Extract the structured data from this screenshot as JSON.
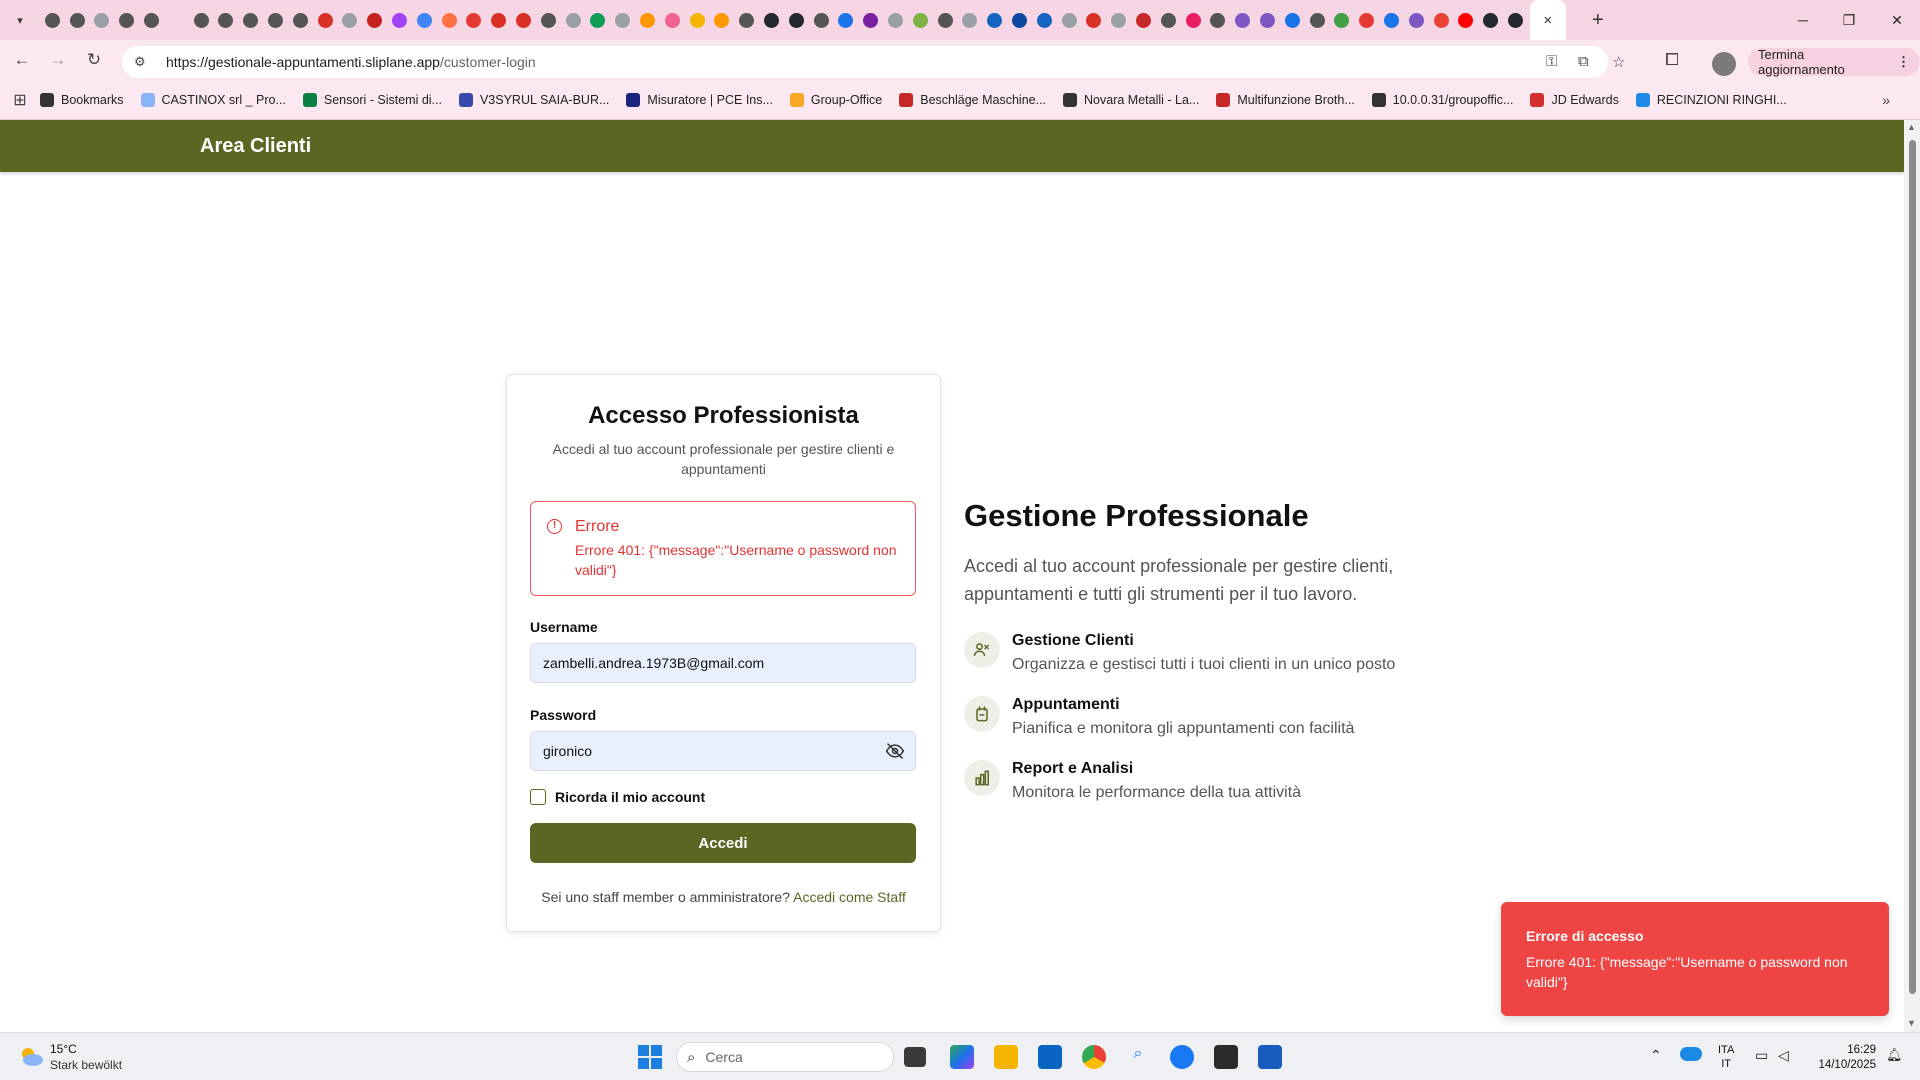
{
  "browser": {
    "tab_favicon_colors": [
      "#555555",
      "#555555",
      "#9aa0a6",
      "#555555",
      "#555555",
      "#f6d6e4",
      "#555555",
      "#555555",
      "#555555",
      "#555555",
      "#555555",
      "#d93025",
      "#9aa0a6",
      "#c5221f",
      "#a142f4",
      "#4285f4",
      "#ff7043",
      "#e53935",
      "#d93025",
      "#d93025",
      "#555555",
      "#9aa0a6",
      "#0f9d58",
      "#9aa0a6",
      "#ff9800",
      "#f06292",
      "#f4b400",
      "#ff9800",
      "#555555",
      "#24292f",
      "#24292f",
      "#555555",
      "#1a73e8",
      "#7b1fa2",
      "#9aa0a6",
      "#7cb342",
      "#555555",
      "#9aa0a6",
      "#1565c0",
      "#0d47a1",
      "#1565c0",
      "#9aa0a6",
      "#d93025",
      "#9aa0a6",
      "#c62828",
      "#555555",
      "#e91e63",
      "#555555",
      "#7e57c2",
      "#7e57c2",
      "#1a73e8",
      "#555555",
      "#43a047",
      "#e53935",
      "#1a73e8",
      "#7e57c2",
      "#ea4335",
      "#ff0000",
      "#24292f",
      "#24292f"
    ],
    "active_tab_close": "×",
    "new_tab": "+",
    "window_controls": {
      "minimize": "─",
      "maximize": "❐",
      "close": "✕"
    },
    "nav": {
      "back": "←",
      "forward": "→",
      "reload": "↻"
    },
    "url_host": "https://gestionale-appuntamenti.sliplane.app",
    "url_path": "/customer-login",
    "update_chip": "Termina aggiornamento",
    "bookmarks": [
      {
        "label": "Bookmarks",
        "color": "#333333"
      },
      {
        "label": "CASTINOX srl _ Pro...",
        "color": "#8ab4f8"
      },
      {
        "label": "Sensori - Sistemi di...",
        "color": "#0b8043"
      },
      {
        "label": "V3SYRUL SAIA-BUR...",
        "color": "#3949ab"
      },
      {
        "label": "Misuratore | PCE Ins...",
        "color": "#1a237e"
      },
      {
        "label": "Group-Office",
        "color": "#f9a825"
      },
      {
        "label": "Beschläge Maschine...",
        "color": "#c62828"
      },
      {
        "label": "Novara Metalli - La...",
        "color": "#333333"
      },
      {
        "label": "Multifunzione Broth...",
        "color": "#c62828"
      },
      {
        "label": "10.0.0.31/groupoffic...",
        "color": "#333333"
      },
      {
        "label": "JD Edwards",
        "color": "#d32f2f"
      },
      {
        "label": "RECINZIONI RINGHI...",
        "color": "#1e88e5"
      }
    ]
  },
  "app": {
    "header_title": "Area Clienti",
    "login": {
      "title": "Accesso Professionista",
      "subtitle": "Accedi al tuo account professionale per gestire clienti e appuntamenti",
      "error_title": "Errore",
      "error_message": "Errore 401: {\"message\":\"Username o password non validi\"}",
      "username_label": "Username",
      "username_value": "zambelli.andrea.1973B@gmail.com",
      "password_label": "Password",
      "password_value": "gironico",
      "remember_label": "Ricorda il mio account",
      "submit_label": "Accedi",
      "staff_prompt": "Sei uno staff member o amministratore?",
      "staff_link": "Accedi come Staff"
    },
    "info": {
      "title": "Gestione Professionale",
      "text": "Accedi al tuo account professionale per gestire clienti, appuntamenti e tutti gli strumenti per il tuo lavoro.",
      "features": [
        {
          "title": "Gestione Clienti",
          "desc": "Organizza e gestisci tutti i tuoi clienti in un unico posto",
          "icon": "users-icon"
        },
        {
          "title": "Appuntamenti",
          "desc": "Pianifica e monitora gli appuntamenti con facilità",
          "icon": "calendar-icon"
        },
        {
          "title": "Report e Analisi",
          "desc": "Monitora le performance della tua attività",
          "icon": "bar-chart-icon"
        }
      ]
    },
    "toast": {
      "title": "Errore di accesso",
      "message": "Errore 401: {\"message\":\"Username o password non validi\"}"
    },
    "accent_color": "#5c6623",
    "error_color": "#e03434"
  },
  "taskbar": {
    "weather_temp": "15°C",
    "weather_desc": "Stark bewölkt",
    "search_placeholder": "Cerca",
    "lang_top": "ITA",
    "lang_bottom": "IT",
    "time": "16:29",
    "date": "14/10/2025"
  }
}
